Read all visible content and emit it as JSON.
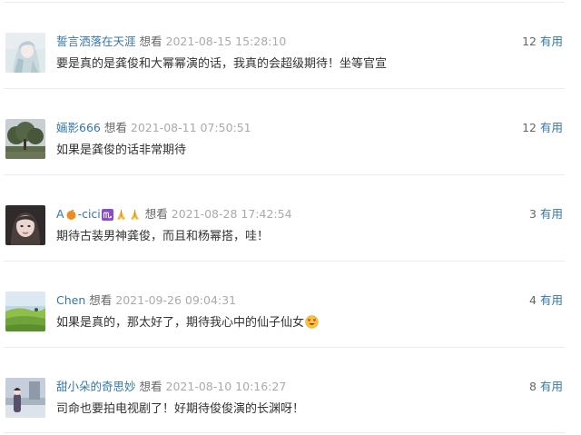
{
  "comments": [
    {
      "username": "誓言洒落在天涯",
      "status": "想看",
      "time": "2021-08-15 15:28:10",
      "votes": "12",
      "useful_label": "有用",
      "text": "要是真的是龚俊和大幂幂演的话，我真的会超级期待！坐等官宣",
      "avatar": "anime-girl-avatar"
    },
    {
      "username": "婳影666",
      "status": "想看",
      "time": "2021-08-11 07:50:51",
      "votes": "12",
      "useful_label": "有用",
      "text": "如果是龚俊的话非常期待",
      "avatar": "tree-landscape-avatar"
    },
    {
      "username_prefix": "A",
      "username_suffix": "-cici",
      "status": "想看",
      "time": "2021-08-28 17:42:54",
      "votes": "3",
      "useful_label": "有用",
      "text": "期待古装男神龚俊，而且和杨幂搭，哇！",
      "avatar": "portrait-avatar",
      "name_emoji": [
        "tangerine-icon",
        "scorpio-icon",
        "folded-hands-icon",
        "folded-hands-icon"
      ]
    },
    {
      "username": "Chen",
      "status": "想看",
      "time": "2021-09-26 09:04:31",
      "votes": "4",
      "useful_label": "有用",
      "text": "如果是真的，那太好了，期待我心中的仙子仙女",
      "avatar": "green-field-avatar",
      "text_emoji": "heart-eyes-face-icon"
    },
    {
      "username": "甜小朵的奇思妙",
      "status": "想看",
      "time": "2021-08-10 10:16:27",
      "votes": "8",
      "useful_label": "有用",
      "text": "司命也要拍电视剧了！好期待俊俊演的长渊呀！",
      "avatar": "winter-scene-avatar"
    }
  ],
  "colors": {
    "link": "#3377aa",
    "meta": "#666666",
    "time": "#aaaaaa",
    "text": "#333333",
    "divider": "#ececec"
  }
}
